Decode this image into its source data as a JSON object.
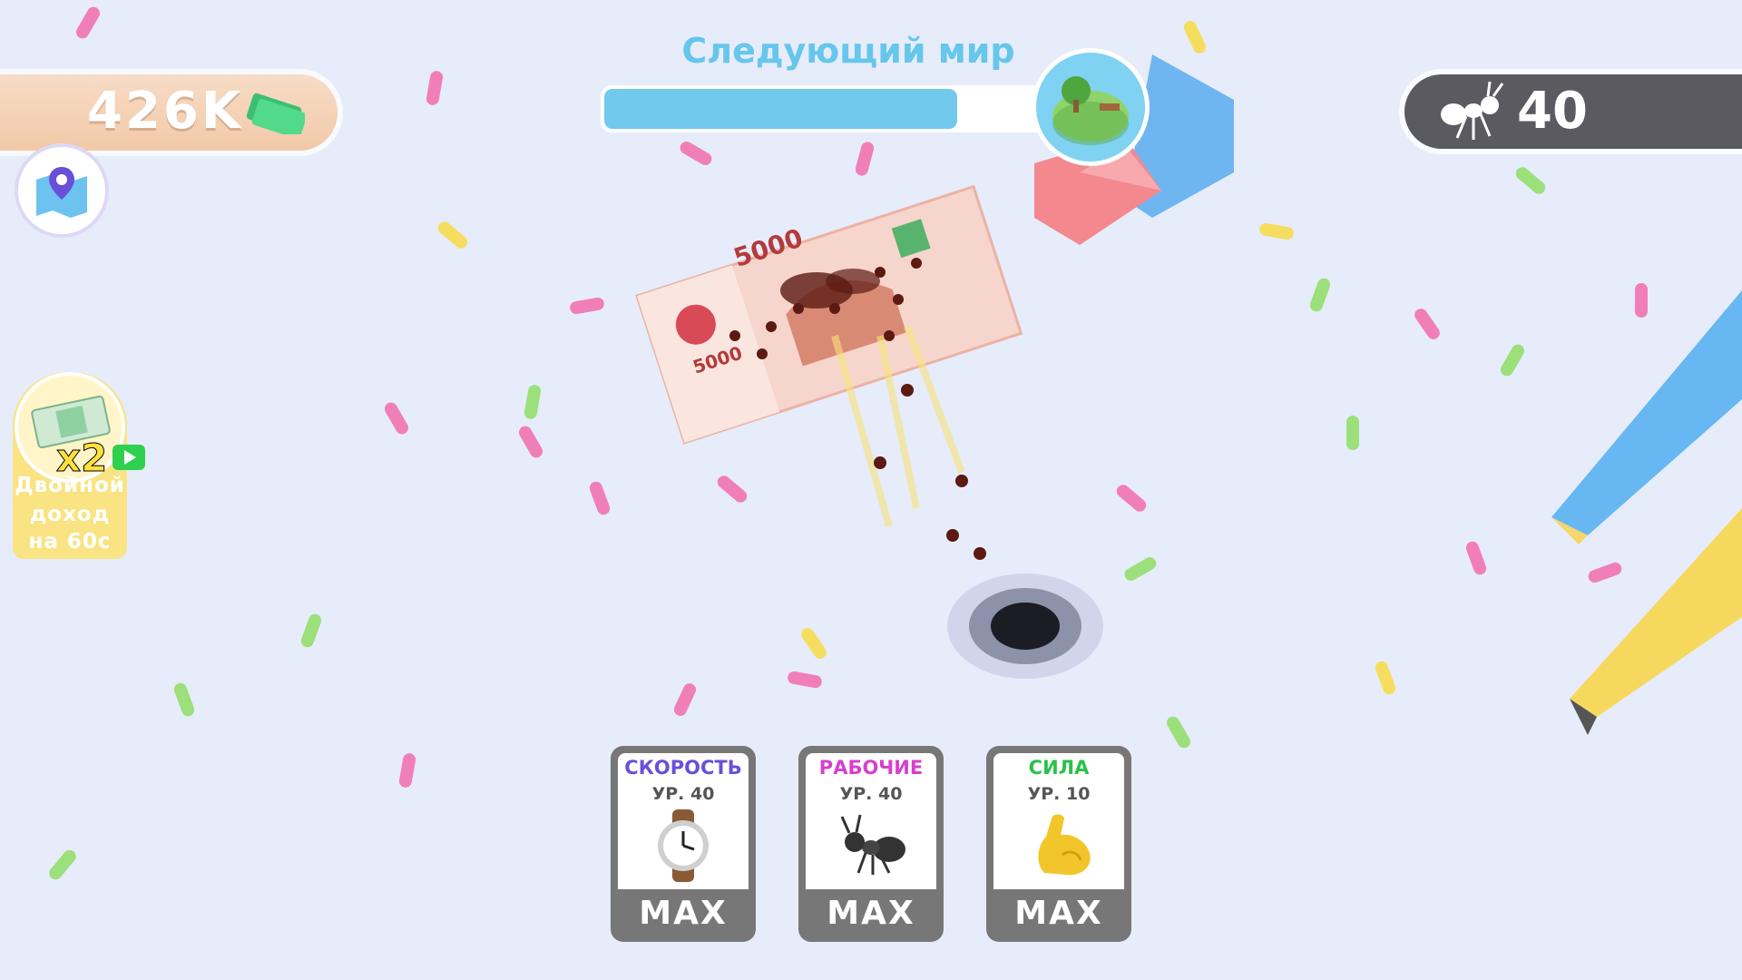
{
  "hud": {
    "money": "426K",
    "ant_count": "40",
    "next_world_label": "Следующий мир",
    "next_world_progress": 0.79
  },
  "double_income": {
    "multiplier": "x2",
    "line1": "Двойной",
    "line2": "доход",
    "line3": "на 60с"
  },
  "banknote": {
    "denomination_top": "5000",
    "denomination_side": "5000"
  },
  "upgrades": [
    {
      "title": "СКОРОСТЬ",
      "level": "УР. 40",
      "state": "MAX",
      "icon": "watch-icon",
      "color": "#6a4fd8"
    },
    {
      "title": "РАБОЧИЕ",
      "level": "УР. 40",
      "state": "MAX",
      "icon": "ant-icon",
      "color": "#d63fcf"
    },
    {
      "title": "СИЛА",
      "level": "УР. 10",
      "state": "MAX",
      "icon": "flexed-bicep-icon",
      "color": "#29c24a"
    }
  ],
  "colors": {
    "background": "#e7ecfa",
    "progress": "#72c9ee",
    "money_panel": "#f2c9a8",
    "ant_panel": "#5a5a60"
  }
}
